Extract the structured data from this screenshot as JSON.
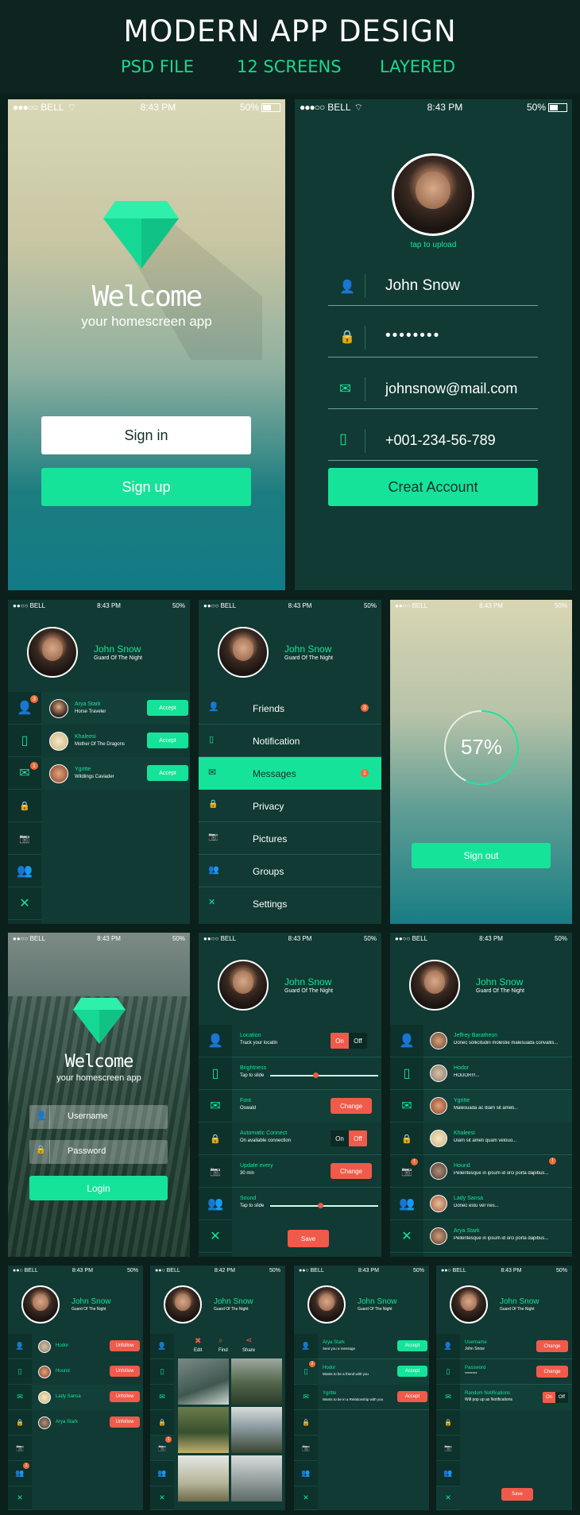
{
  "header": {
    "title": "MODERN APP DESIGN",
    "tags": [
      "PSD FILE",
      "12 SCREENS",
      "LAYERED"
    ]
  },
  "status": {
    "carrier": "BELL",
    "time": "8:43 PM",
    "time_alt": "8:42 PM",
    "battery": "50%"
  },
  "colors": {
    "accent": "#16e39a",
    "danger": "#f05a4a",
    "bg": "#103a33"
  },
  "welcome": {
    "title": "Welcome",
    "subtitle": "your homescreen app",
    "signin": "Sign in",
    "signup": "Sign up"
  },
  "register": {
    "upload": "tap to upload",
    "name": "John Snow",
    "password": "••••••••",
    "email": "johnsnow@mail.com",
    "phone": "+001-234-56-789",
    "button": "Creat Account"
  },
  "profile": {
    "name": "John Snow",
    "title": "Guard Of The Night"
  },
  "requests": [
    {
      "name": "Arya Stark",
      "desc": "Horse Traveler",
      "action": "Accept"
    },
    {
      "name": "Khaleesi",
      "desc": "Mother Of The Dragons",
      "action": "Accept"
    },
    {
      "name": "Ygritte",
      "desc": "Wildlings Caviader",
      "action": "Accept"
    }
  ],
  "sidebar_badges": {
    "users": "3",
    "messages": "1"
  },
  "menu": {
    "items": [
      "Friends",
      "Notification",
      "Messages",
      "Privacy",
      "Pictures",
      "Groups",
      "Settings"
    ],
    "friends_badge": "3",
    "messages_badge": "1"
  },
  "loading": {
    "percent": "57%",
    "button": "Sign out",
    "progress": 0.57
  },
  "login": {
    "title": "Welcome",
    "subtitle": "your homescreen app",
    "username": "Username",
    "password": "Password",
    "button": "Login"
  },
  "settings": [
    {
      "label": "Location",
      "desc": "Track your locatin",
      "on": "On",
      "off": "Off"
    },
    {
      "label": "Brightness",
      "desc": "Tap to slide"
    },
    {
      "label": "Font",
      "desc": "Oswald",
      "action": "Change"
    },
    {
      "label": "Automatic Connect",
      "desc": "On available connection",
      "on": "On",
      "off": "Off"
    },
    {
      "label": "Update every",
      "desc": "30 min",
      "action": "Change"
    },
    {
      "label": "Sound",
      "desc": "Tap to slide"
    }
  ],
  "settings_save": "Save",
  "messages": [
    {
      "name": "Jeffrey Baratheon",
      "text": "Donec sollicitudin molestie malesuada convallis..."
    },
    {
      "name": "Hodor",
      "text": "HODOR!!!..."
    },
    {
      "name": "Ygritte",
      "text": "Malesuada ac diam sit ameti..."
    },
    {
      "name": "Khaleesi",
      "text": "Diam sit ameti quam velouo..."
    },
    {
      "name": "Hound",
      "text": "Pellentesque in ipsum id orci porta dapibus..."
    },
    {
      "name": "Lady Sansa",
      "text": "Donec estu ver nes..."
    },
    {
      "name": "Arya Stark",
      "text": "Pellentesque in ipsum id orci porta dapibus..."
    }
  ],
  "friends": {
    "list": [
      "Hodor",
      "Hound",
      "Lady Sansa",
      "Arya Stark"
    ],
    "action": "Unfollow",
    "badge": "1"
  },
  "gallery": {
    "tools": [
      "Edit",
      "Find",
      "Share"
    ],
    "badge": "1"
  },
  "notifs": [
    {
      "name": "Arya Stark",
      "text": "Sent you a message",
      "action": "Accept"
    },
    {
      "name": "Hodor",
      "text": "Wants to be a friend with you",
      "action": "Accept"
    },
    {
      "name": "Ygritte",
      "text": "Wants to be in a Relationship with you",
      "action": "Accept"
    }
  ],
  "notifs_badge": "2",
  "account": [
    {
      "label": "Username",
      "value": "John Snow",
      "action": "Change"
    },
    {
      "label": "Password",
      "value": "********",
      "action": "Change"
    },
    {
      "label": "Random Notifications",
      "value": "Will pop up as Notifications",
      "on": "On",
      "off": "Off"
    }
  ],
  "account_save": "Save"
}
